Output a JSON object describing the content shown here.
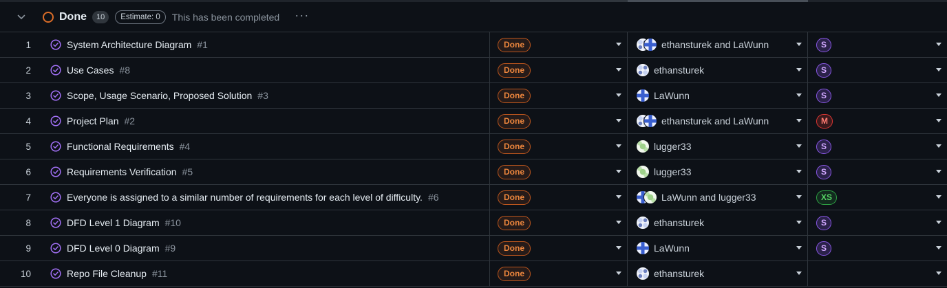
{
  "group": {
    "title": "Done",
    "count": "10",
    "estimate": "Estimate: 0",
    "description": "This has been completed",
    "more_label": "···",
    "status_color": "#db6d28"
  },
  "rows": [
    {
      "num": "1",
      "title": "System Architecture Diagram",
      "issue": "#1",
      "status": "Done",
      "assignees": "ethansturek and LaWunn",
      "avatars": [
        "eth",
        "law"
      ],
      "size": "S"
    },
    {
      "num": "2",
      "title": "Use Cases",
      "issue": "#8",
      "status": "Done",
      "assignees": "ethansturek",
      "avatars": [
        "eth"
      ],
      "size": "S"
    },
    {
      "num": "3",
      "title": "Scope, Usage Scenario, Proposed Solution",
      "issue": "#3",
      "status": "Done",
      "assignees": "LaWunn",
      "avatars": [
        "law"
      ],
      "size": "S"
    },
    {
      "num": "4",
      "title": "Project Plan",
      "issue": "#2",
      "status": "Done",
      "assignees": "ethansturek and LaWunn",
      "avatars": [
        "eth",
        "law"
      ],
      "size": "M"
    },
    {
      "num": "5",
      "title": "Functional Requirements",
      "issue": "#4",
      "status": "Done",
      "assignees": "lugger33",
      "avatars": [
        "lug"
      ],
      "size": "S"
    },
    {
      "num": "6",
      "title": "Requirements Verification",
      "issue": "#5",
      "status": "Done",
      "assignees": "lugger33",
      "avatars": [
        "lug"
      ],
      "size": "S"
    },
    {
      "num": "7",
      "title": "Everyone is assigned to a similar number of requirements for each level of difficulty.",
      "issue": "#6",
      "status": "Done",
      "assignees": "LaWunn and lugger33",
      "avatars": [
        "law",
        "lug"
      ],
      "size": "XS"
    },
    {
      "num": "8",
      "title": "DFD Level 1 Diagram",
      "issue": "#10",
      "status": "Done",
      "assignees": "ethansturek",
      "avatars": [
        "eth"
      ],
      "size": "S"
    },
    {
      "num": "9",
      "title": "DFD Level 0 Diagram",
      "issue": "#9",
      "status": "Done",
      "assignees": "LaWunn",
      "avatars": [
        "law"
      ],
      "size": "S"
    },
    {
      "num": "10",
      "title": "Repo File Cleanup",
      "issue": "#11",
      "status": "Done",
      "assignees": "ethansturek",
      "avatars": [
        "eth"
      ],
      "size": ""
    }
  ]
}
